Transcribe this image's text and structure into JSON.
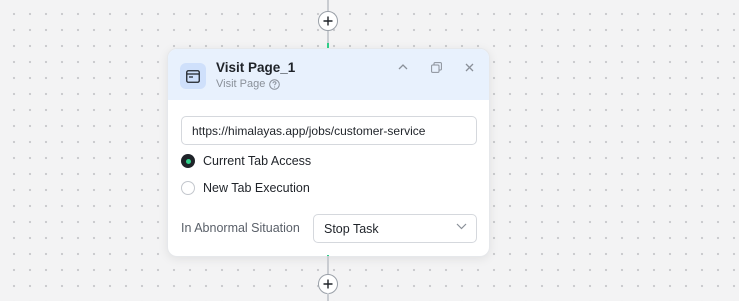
{
  "node": {
    "title": "Visit Page_1",
    "subtitle": "Visit Page",
    "icon": "browser-window-icon",
    "header_color": "#e8f1fd",
    "url_value": "https://himalayas.app/jobs/customer-service",
    "tab_options": [
      {
        "label": "Current Tab Access",
        "selected": true
      },
      {
        "label": "New Tab Execution",
        "selected": false
      }
    ],
    "abnormal": {
      "label": "In Abnormal Situation",
      "selected": "Stop Task"
    }
  },
  "colors": {
    "accent": "#2fd08a",
    "radio_selected": "#1f2329"
  }
}
